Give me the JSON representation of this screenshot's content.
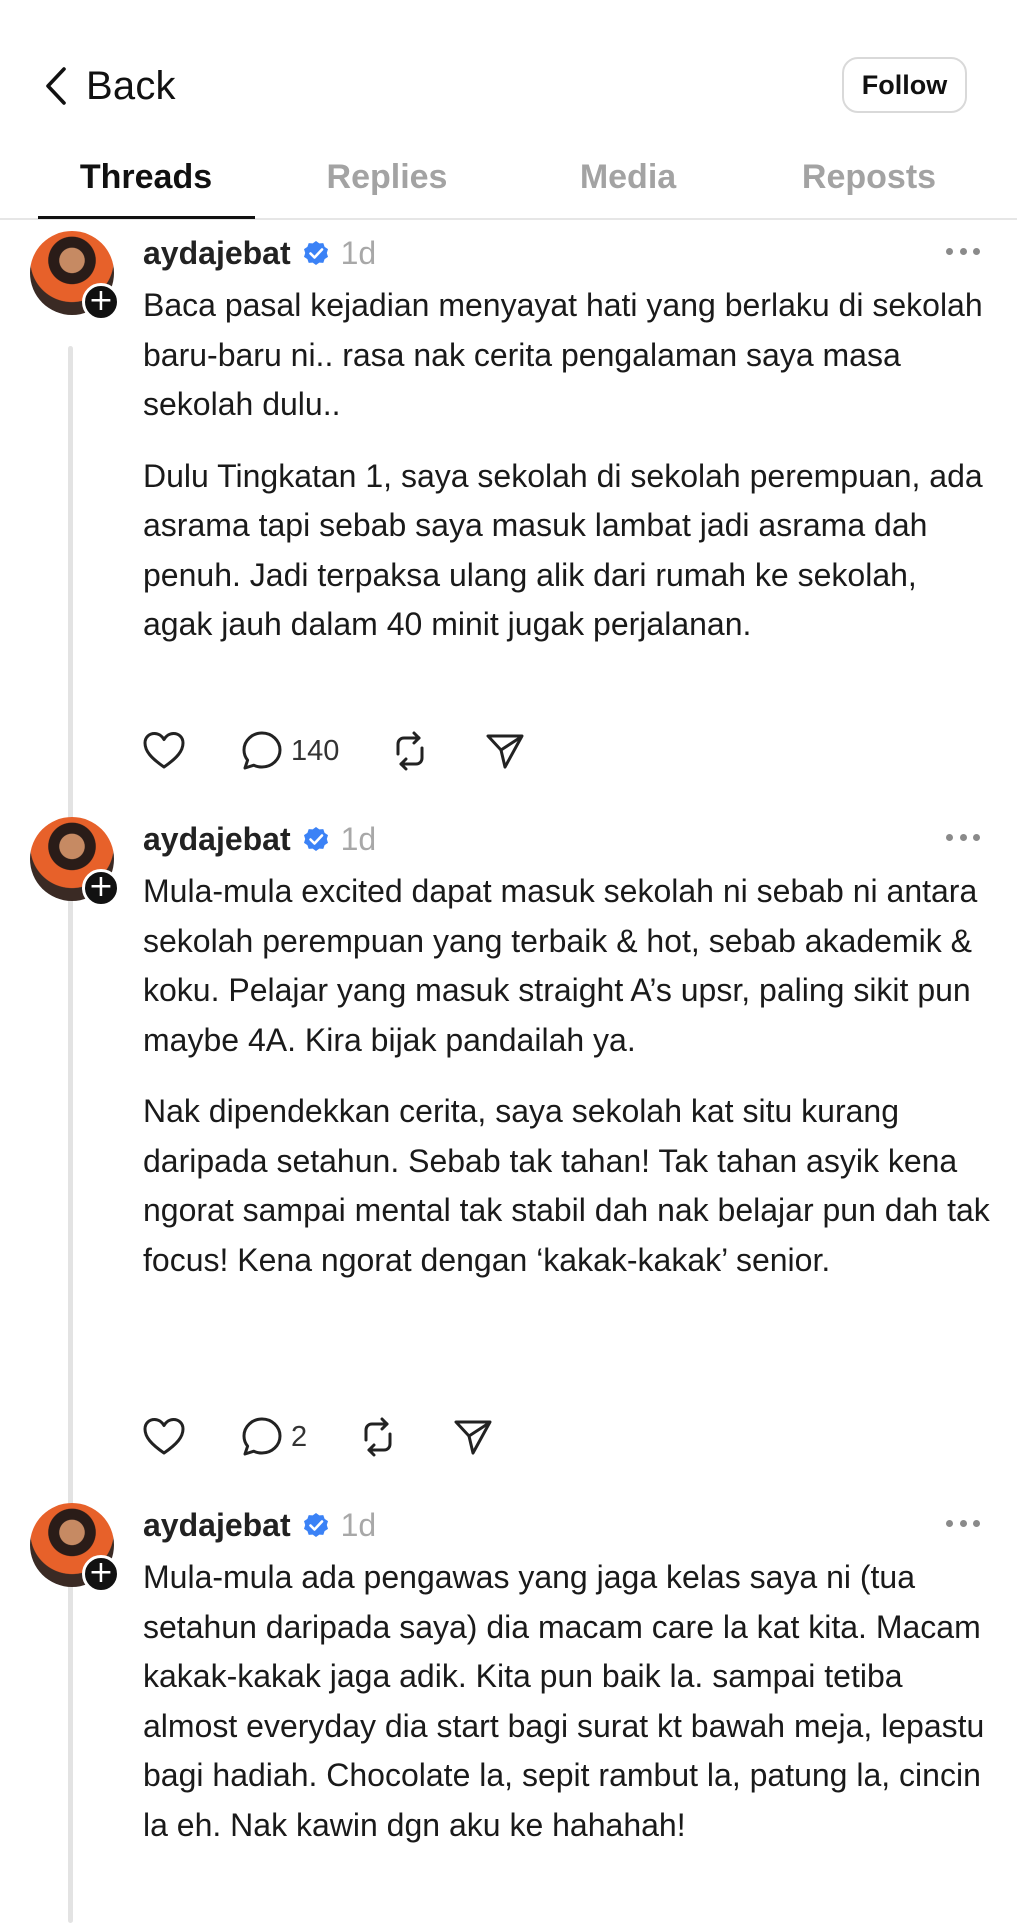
{
  "header": {
    "back_label": "Back",
    "follow_label": "Follow"
  },
  "tabs": [
    {
      "label": "Threads",
      "active": true
    },
    {
      "label": "Replies",
      "active": false
    },
    {
      "label": "Media",
      "active": false
    },
    {
      "label": "Reposts",
      "active": false
    }
  ],
  "posts": [
    {
      "username": "aydajebat",
      "verified": true,
      "time": "1d",
      "paragraphs": [
        "Baca pasal kejadian menyayat hati yang berlaku di sekolah baru-baru ni.. rasa nak cerita pengalaman saya masa sekolah dulu..",
        "Dulu Tingkatan 1, saya sekolah di sekolah perempuan, ada asrama tapi sebab saya masuk lambat jadi asrama dah penuh. Jadi terpaksa ulang alik dari rumah ke sekolah, agak jauh dalam 40 minit jugak perjalanan."
      ],
      "reply_count": "140"
    },
    {
      "username": "aydajebat",
      "verified": true,
      "time": "1d",
      "paragraphs": [
        "Mula-mula excited dapat masuk sekolah ni sebab ni antara sekolah perempuan yang terbaik & hot, sebab akademik & koku. Pelajar yang masuk straight A’s upsr, paling sikit pun maybe 4A. Kira bijak pandailah ya.",
        "Nak dipendekkan cerita, saya sekolah kat situ kurang daripada setahun. Sebab tak tahan! Tak tahan asyik kena ngorat sampai mental tak stabil dah nak belajar pun dah tak focus! Kena ngorat dengan ‘kakak-kakak’ senior."
      ],
      "reply_count": "2"
    },
    {
      "username": "aydajebat",
      "verified": true,
      "time": "1d",
      "paragraphs": [
        "Mula-mula ada pengawas yang jaga kelas saya ni (tua setahun daripada saya) dia macam care la kat kita. Macam kakak-kakak jaga adik. Kita pun baik la. sampai tetiba almost everyday dia start bagi surat kt bawah meja, lepastu bagi hadiah. Chocolate la, sepit rambut la, patung la, cincin la eh. Nak kawin dgn aku ke hahahah!"
      ],
      "reply_count": ""
    }
  ],
  "colors": {
    "verified_blue": "#3b82f6",
    "muted_text": "#a8a8a8",
    "thread_line": "#e3e3e3"
  },
  "icons": {
    "back": "chevron-left-icon",
    "like": "heart-icon",
    "reply": "comment-bubble-icon",
    "repost": "repost-icon",
    "share": "send-icon",
    "more": "ellipsis-icon",
    "verified": "verified-badge-icon"
  }
}
